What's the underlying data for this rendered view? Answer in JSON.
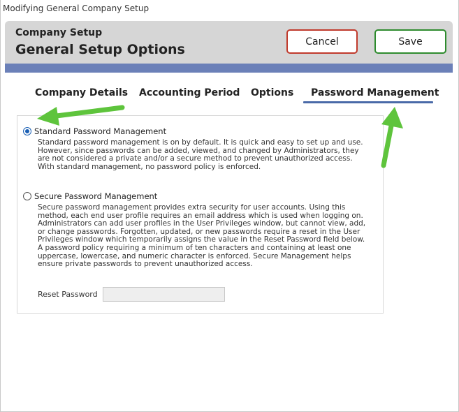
{
  "window": {
    "title": "Modifying General Company Setup"
  },
  "header": {
    "subtitle": "Company Setup",
    "title": "General Setup Options",
    "cancel_label": "Cancel",
    "save_label": "Save"
  },
  "tabs": [
    {
      "label": "Company Details",
      "active": false
    },
    {
      "label": "Accounting Period",
      "active": false
    },
    {
      "label": "Options",
      "active": false
    },
    {
      "label": "Password Management",
      "active": true
    }
  ],
  "password": {
    "standard": {
      "label": "Standard Password Management",
      "selected": true,
      "description": "Standard password management is on by default. It is quick and easy to set up and use. However, since passwords can be added, viewed, and changed by Administrators, they are not considered a private and/or a secure method to prevent unauthorized access. With standard management, no password policy is enforced."
    },
    "secure": {
      "label": "Secure Password Management",
      "selected": false,
      "description": "Secure password management provides extra security for user accounts. Using this method, each end user profile requires an email address which is used when logging on. Administrators can add user profiles in the User Privileges window, but cannot view, add, or change passwords. Forgotten, updated, or new passwords require a reset in the User Privileges window which temporarily assigns the value in the Reset Password field below. A password policy requiring a minimum of ten characters and containing at least one uppercase, lowercase, and numeric character is enforced. Secure Management helps ensure private passwords to prevent unauthorized access."
    },
    "reset_label": "Reset Password",
    "reset_value": ""
  },
  "colors": {
    "header_bg": "#d6d6d6",
    "accent_bar": "#6b80b8",
    "tab_underline": "#4a6aa8",
    "cancel_border": "#c0392b",
    "save_border": "#2e8b2e",
    "annotation_arrow": "#5ec43c",
    "radio_selected": "#1a5fb4"
  }
}
